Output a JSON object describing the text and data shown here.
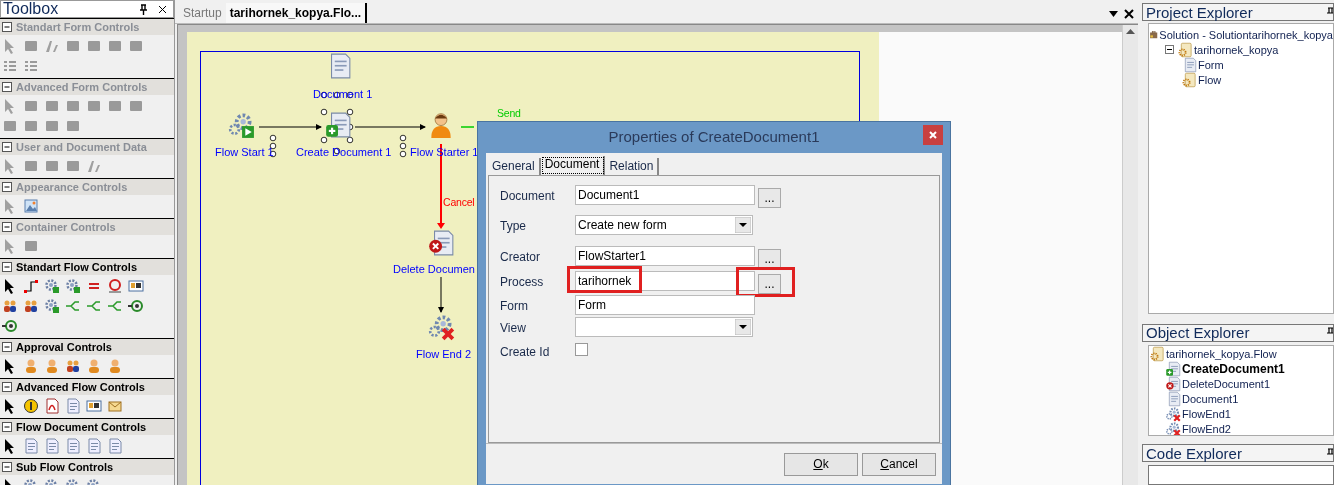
{
  "toolbox": {
    "title": "Toolbox",
    "sections": [
      {
        "title": "Standart Form Controls",
        "disabled": true
      },
      {
        "title": "Advanced Form Controls",
        "disabled": true
      },
      {
        "title": "User and Document Data",
        "disabled": true
      },
      {
        "title": "Appearance Controls",
        "disabled": true
      },
      {
        "title": "Container Controls",
        "disabled": true
      },
      {
        "title": "Standart Flow Controls",
        "disabled": false
      },
      {
        "title": "Approval Controls",
        "disabled": false
      },
      {
        "title": "Advanced Flow Controls",
        "disabled": false
      },
      {
        "title": "Flow Document Controls",
        "disabled": false
      },
      {
        "title": "Sub Flow Controls",
        "disabled": false
      }
    ]
  },
  "document_tabs": [
    {
      "label": "Startup",
      "selected": false
    },
    {
      "label": "tarihornek_kopya.Flo...",
      "selected": true
    }
  ],
  "canvas": {
    "nodes": [
      {
        "label": "Document 1",
        "kind": "document",
        "selected": false
      },
      {
        "label": "Flow Start 1",
        "kind": "flow-start",
        "selected": false
      },
      {
        "label": "Create Document 1",
        "kind": "create-document",
        "selected": true
      },
      {
        "label": "Flow Starter 1",
        "kind": "person",
        "selected": false
      },
      {
        "label": "Delete Documen",
        "kind": "delete-document",
        "selected": false
      },
      {
        "label": "Flow End 2",
        "kind": "flow-end",
        "selected": false
      }
    ],
    "connector_labels": [
      {
        "label": "Send",
        "color": "#00cc00"
      },
      {
        "label": "Cancel",
        "color": "#ff0000"
      }
    ]
  },
  "dialog": {
    "title": "Properties of CreateDocument1",
    "tabs": [
      {
        "label": "General",
        "selected": false
      },
      {
        "label": "Document",
        "selected": true
      },
      {
        "label": "Relation",
        "selected": false
      }
    ],
    "fields": [
      {
        "label": "Document",
        "kind": "text",
        "value": "Document1",
        "browse": "..."
      },
      {
        "label": "Type",
        "kind": "select",
        "value": "Create new form"
      },
      {
        "label": "Creator",
        "kind": "text",
        "value": "FlowStarter1",
        "browse": "..."
      },
      {
        "label": "Process",
        "kind": "text",
        "value": "tarihornek",
        "browse": "...",
        "value_highlighted": true,
        "browse_highlighted": true
      },
      {
        "label": "Form",
        "kind": "text",
        "value": "Form"
      },
      {
        "label": "View",
        "kind": "select"
      },
      {
        "label": "Create Id",
        "kind": "checkbox",
        "checked": false
      }
    ],
    "buttons": [
      "Ok",
      "Cancel"
    ]
  },
  "project_explorer": {
    "title": "Project Explorer",
    "tree": [
      {
        "label": "Solution - Solutiontarihornek_kopya",
        "kind": "solution",
        "children": [
          {
            "label": "tarihornek_kopya",
            "kind": "flow",
            "expanded": true,
            "children": [
              {
                "label": "Form",
                "kind": "document"
              },
              {
                "label": "Flow",
                "kind": "flow"
              }
            ]
          }
        ]
      }
    ]
  },
  "object_explorer": {
    "title": "Object Explorer",
    "tree": [
      {
        "label": "tarihornek_kopya.Flow",
        "kind": "flow",
        "children": [
          {
            "label": "CreateDocument1",
            "kind": "create-document",
            "selected": true
          },
          {
            "label": "DeleteDocument1",
            "kind": "delete-document",
            "selected": false
          },
          {
            "label": "Document1",
            "kind": "document",
            "selected": false
          },
          {
            "label": "FlowEnd1",
            "kind": "flow-end",
            "selected": false
          },
          {
            "label": "FlowEnd2",
            "kind": "flow-end",
            "selected": false
          }
        ]
      }
    ]
  },
  "code_explorer": {
    "title": "Code Explorer"
  }
}
